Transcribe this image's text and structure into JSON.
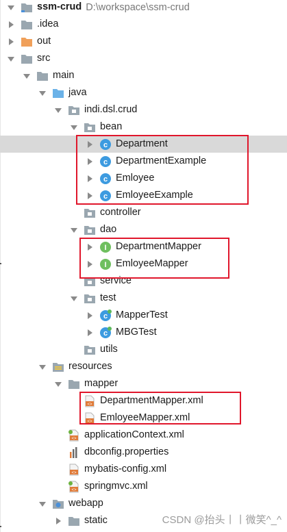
{
  "tree": [
    {
      "name": "project-root",
      "label": "ssm-crud",
      "path": "D:\\workspace\\ssm-crud",
      "depth": 0,
      "arrow": "down",
      "icon": "project-folder"
    },
    {
      "name": "idea-folder",
      "label": ".idea",
      "depth": 0,
      "arrow": "right",
      "icon": "folder"
    },
    {
      "name": "out-folder",
      "label": "out",
      "depth": 0,
      "arrow": "right",
      "icon": "folder-orange"
    },
    {
      "name": "src-folder",
      "label": "src",
      "depth": 0,
      "arrow": "down",
      "icon": "folder"
    },
    {
      "name": "main-folder",
      "label": "main",
      "depth": 1,
      "arrow": "down",
      "icon": "folder"
    },
    {
      "name": "java-folder",
      "label": "java",
      "depth": 2,
      "arrow": "down",
      "icon": "folder-blue"
    },
    {
      "name": "package-crud",
      "label": "indi.dsl.crud",
      "depth": 3,
      "arrow": "down",
      "icon": "package"
    },
    {
      "name": "package-bean",
      "label": "bean",
      "depth": 4,
      "arrow": "down",
      "icon": "package"
    },
    {
      "name": "class-department",
      "label": "Department",
      "depth": 5,
      "arrow": "right",
      "icon": "class",
      "selected": true
    },
    {
      "name": "class-department-example",
      "label": "DepartmentExample",
      "depth": 5,
      "arrow": "right",
      "icon": "class"
    },
    {
      "name": "class-emloyee",
      "label": "Emloyee",
      "depth": 5,
      "arrow": "right",
      "icon": "class"
    },
    {
      "name": "class-emloyee-example",
      "label": "EmloyeeExample",
      "depth": 5,
      "arrow": "right",
      "icon": "class"
    },
    {
      "name": "package-controller",
      "label": "controller",
      "depth": 4,
      "arrow": "none",
      "icon": "package"
    },
    {
      "name": "package-dao",
      "label": "dao",
      "depth": 4,
      "arrow": "down",
      "icon": "package"
    },
    {
      "name": "interface-department-mapper",
      "label": "DepartmentMapper",
      "depth": 5,
      "arrow": "right",
      "icon": "interface"
    },
    {
      "name": "interface-emloyee-mapper",
      "label": "EmloyeeMapper",
      "depth": 5,
      "arrow": "right",
      "icon": "interface"
    },
    {
      "name": "package-service",
      "label": "service",
      "depth": 4,
      "arrow": "none",
      "icon": "package"
    },
    {
      "name": "package-test",
      "label": "test",
      "depth": 4,
      "arrow": "down",
      "icon": "package"
    },
    {
      "name": "class-mapper-test",
      "label": "MapperTest",
      "depth": 5,
      "arrow": "right",
      "icon": "class-test"
    },
    {
      "name": "class-mbg-test",
      "label": "MBGTest",
      "depth": 5,
      "arrow": "right",
      "icon": "class-test"
    },
    {
      "name": "package-utils",
      "label": "utils",
      "depth": 4,
      "arrow": "none",
      "icon": "package"
    },
    {
      "name": "resources-folder",
      "label": "resources",
      "depth": 2,
      "arrow": "down",
      "icon": "folder-resources"
    },
    {
      "name": "mapper-folder",
      "label": "mapper",
      "depth": 3,
      "arrow": "down",
      "icon": "folder"
    },
    {
      "name": "xml-department-mapper",
      "label": "DepartmentMapper.xml",
      "depth": 4,
      "arrow": "none",
      "icon": "xml"
    },
    {
      "name": "xml-emloyee-mapper",
      "label": "EmloyeeMapper.xml",
      "depth": 4,
      "arrow": "none",
      "icon": "xml"
    },
    {
      "name": "xml-application-context",
      "label": "applicationContext.xml",
      "depth": 3,
      "arrow": "none",
      "icon": "xml-spring"
    },
    {
      "name": "properties-dbconfig",
      "label": "dbconfig.properties",
      "depth": 3,
      "arrow": "none",
      "icon": "properties"
    },
    {
      "name": "xml-mybatis-config",
      "label": "mybatis-config.xml",
      "depth": 3,
      "arrow": "none",
      "icon": "xml"
    },
    {
      "name": "xml-springmvc",
      "label": "springmvc.xml",
      "depth": 3,
      "arrow": "none",
      "icon": "xml-spring"
    },
    {
      "name": "webapp-folder",
      "label": "webapp",
      "depth": 2,
      "arrow": "down",
      "icon": "folder-web"
    },
    {
      "name": "static-folder",
      "label": "static",
      "depth": 3,
      "arrow": "right",
      "icon": "folder"
    }
  ],
  "watermark": "CSDN @抬头丨丨微笑^_^",
  "colors": {
    "highlight_box": "#e0162b",
    "selected_row": "#d9d9d9"
  }
}
